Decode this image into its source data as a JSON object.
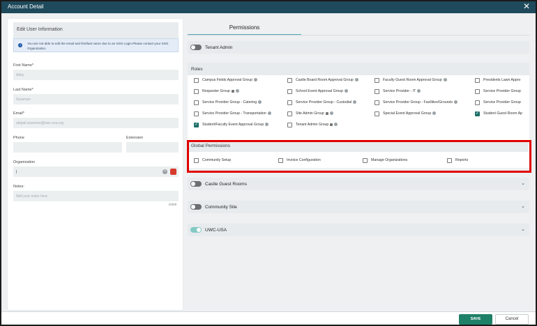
{
  "window": {
    "title": "Account Detail",
    "close_glyph": "✕"
  },
  "left": {
    "header": "Edit User Information",
    "info_text": "You are not able to edit the email and first/last name due to an SSO Login.Please contact your SSO Organization.",
    "first_name": {
      "label": "First Name*",
      "value": "Abby"
    },
    "last_name": {
      "label": "Last Name*",
      "value": "Sussman"
    },
    "email": {
      "label": "Email*",
      "value": "abigail.sussman@uwc-usa.org"
    },
    "phone": {
      "label": "Phone",
      "value": ""
    },
    "extension": {
      "label": "Extension",
      "value": ""
    },
    "organization": {
      "label": "Organization",
      "value": "|"
    },
    "notes": {
      "label": "Notes:",
      "placeholder": "Add your notes here",
      "counter": "0/300"
    }
  },
  "tabs": {
    "permissions": "Permissions"
  },
  "tenant_admin": {
    "label": "Tenant Admin",
    "enabled": false
  },
  "roles": {
    "header": "Roles",
    "items": [
      {
        "label": "Campus Fields Approval Group",
        "checked": false,
        "lock": false
      },
      {
        "label": "Castle Board Room Approval Group",
        "checked": false,
        "lock": false
      },
      {
        "label": "Faculty Guest Room Approval Group",
        "checked": false,
        "lock": false
      },
      {
        "label": "Presidents Lawn Appro",
        "checked": false,
        "lock": false
      },
      {
        "label": "Requester Group",
        "checked": false,
        "lock": true
      },
      {
        "label": "School Event Approval Group",
        "checked": false,
        "lock": false
      },
      {
        "label": "Service Provider - IT",
        "checked": false,
        "lock": false
      },
      {
        "label": "Service Provider Group",
        "checked": false,
        "lock": false
      },
      {
        "label": "Service Provider Group - Catering",
        "checked": false,
        "lock": false
      },
      {
        "label": "Service Provider Group - Custodial",
        "checked": false,
        "lock": false
      },
      {
        "label": "Service Provider Group - Facilities/Grounds",
        "checked": false,
        "lock": false
      },
      {
        "label": "Service Provider Group",
        "checked": false,
        "lock": false
      },
      {
        "label": "Service Provider Group - Transportation",
        "checked": false,
        "lock": false
      },
      {
        "label": "Site Admin Group",
        "checked": false,
        "lock": true
      },
      {
        "label": "Special Event Approval Group",
        "checked": false,
        "lock": false
      },
      {
        "label": "Student Guest Room Ap",
        "checked": true,
        "lock": false
      },
      {
        "label": "Student/Faculty Event Approval Group",
        "checked": true,
        "lock": false
      },
      {
        "label": "Tenant Admin Group",
        "checked": false,
        "lock": true
      }
    ]
  },
  "global_permissions": {
    "header": "Global Permissions",
    "items": [
      {
        "label": "Community Setup",
        "checked": false
      },
      {
        "label": "Invoice Configuration",
        "checked": false
      },
      {
        "label": "Manage Organizations",
        "checked": false
      },
      {
        "label": "Reports",
        "checked": false
      }
    ]
  },
  "sites": [
    {
      "label": "Castle Guest Rooms",
      "enabled": false
    },
    {
      "label": "Community Site",
      "enabled": false
    },
    {
      "label": "UWC-USA",
      "enabled": true
    }
  ],
  "footer": {
    "save": "SAVE",
    "cancel": "Cancel"
  },
  "colors": {
    "titlebar": "#1f4a5c",
    "save": "#1f8068",
    "highlight": "#e00000",
    "toggle_on": "#83c9c4"
  }
}
